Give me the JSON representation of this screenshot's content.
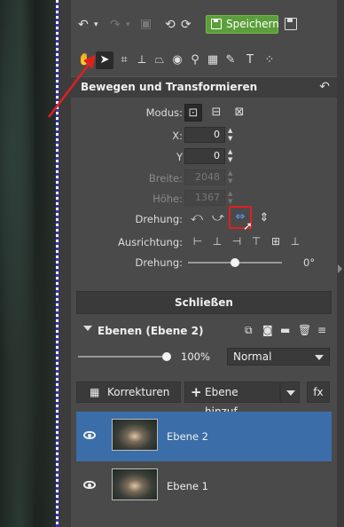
{
  "colors": {
    "accent_save": "#5b9e3a",
    "selected_row": "#3b6ea8",
    "highlight_box": "#e02020",
    "annotation_arrow": "#e02020"
  },
  "toolbar": {
    "undo_icon": "undo-icon",
    "redo_icon": "redo-icon",
    "save_label": "Speichern"
  },
  "transform": {
    "section_title": "Bewegen und Transformieren",
    "modus_label": "Modus:",
    "x_label": "X:",
    "x_value": "0",
    "y_label": "Y",
    "y_value": "0",
    "width_label": "Breite:",
    "width_value": "2048",
    "height_label": "Höhe:",
    "height_value": "1367",
    "rotation_label": "Drehung:",
    "align_label": "Ausrichtung:",
    "rotation_slider_label": "Drehung:",
    "rotation_slider_fraction": 0.5,
    "rotation_value": "0°"
  },
  "close_label": "Schließen",
  "layers": {
    "title": "Ebenen (Ebene 2)",
    "opacity_value": "100%",
    "opacity_fraction": 1.0,
    "blend_mode": "Normal",
    "corrections_label": "Korrekturen",
    "add_layer_label": "Ebene hinzuf...",
    "fx_label": "fx",
    "items": [
      {
        "name": "Ebene 2",
        "selected": true
      },
      {
        "name": "Ebene 1",
        "selected": false
      }
    ]
  }
}
